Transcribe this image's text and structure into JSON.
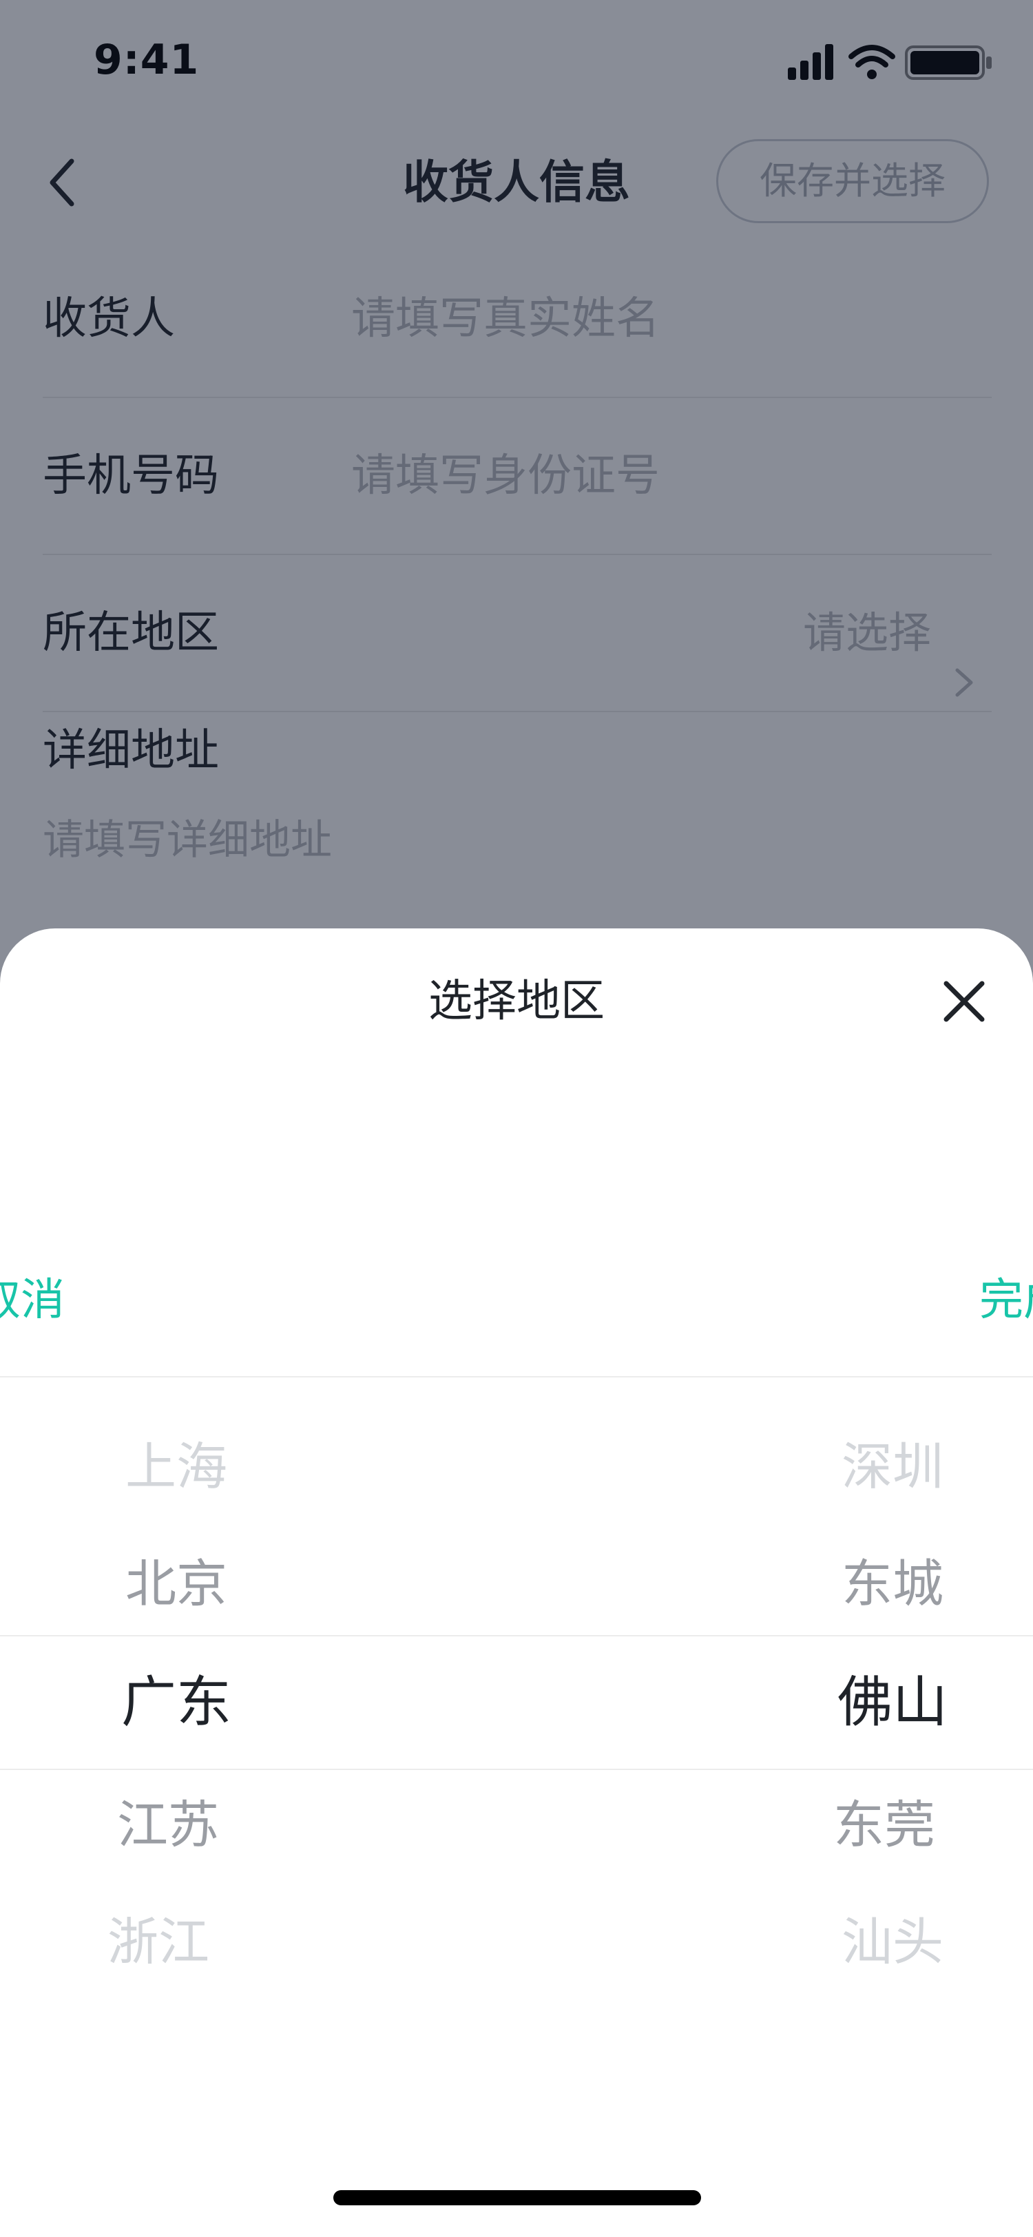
{
  "status_bar": {
    "time": "9:41"
  },
  "nav": {
    "title": "收货人信息",
    "save_label": "保存并选择"
  },
  "form": {
    "receiver_label": "收货人",
    "receiver_placeholder": "请填写真实姓名",
    "phone_label": "手机号码",
    "phone_placeholder": "请填写身份证号",
    "region_label": "所在地区",
    "region_value": "请选择",
    "detail_label": "详细地址",
    "detail_placeholder": "请填写详细地址"
  },
  "sheet": {
    "title": "选择地区",
    "cancel_label": "取消",
    "done_label": "完成",
    "provinces": [
      "上海",
      "北京",
      "广东",
      "江苏",
      "浙江"
    ],
    "cities": [
      "深圳",
      "东城",
      "佛山",
      "东莞",
      "汕头"
    ],
    "selected_province": "广东",
    "selected_city": "佛山"
  },
  "colors": {
    "accent": "#18c4a8",
    "overlay": "rgba(20, 28, 48, 0.50)",
    "placeholder": "#b6b9be"
  }
}
